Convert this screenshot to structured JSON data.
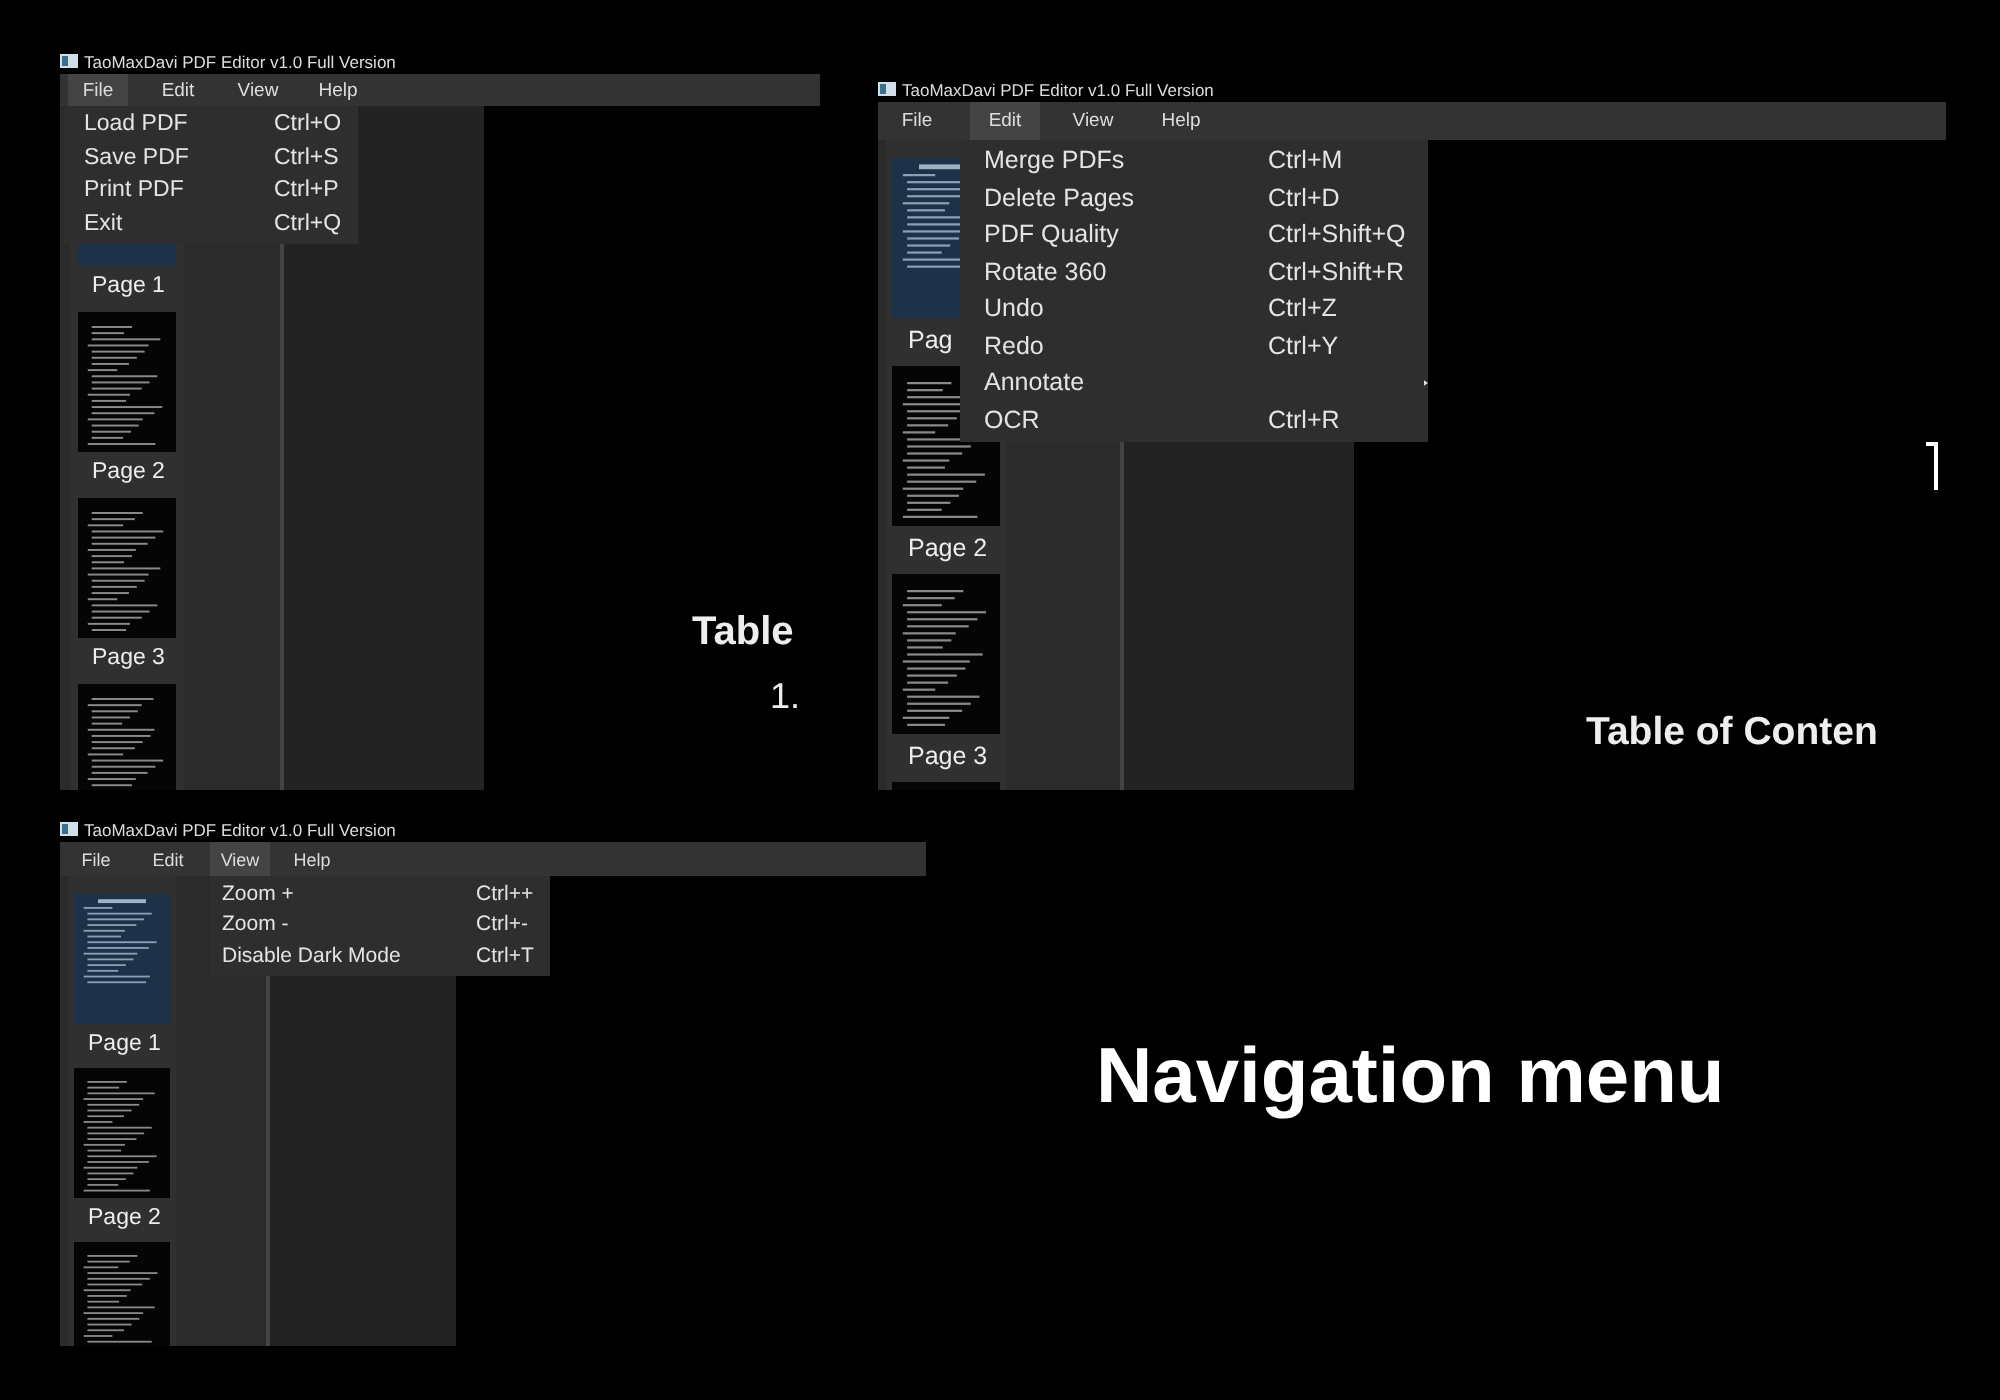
{
  "screens": [
    {
      "title": "TaoMaxDavi PDF Editor v1.0 Full Version",
      "menus": [
        {
          "label": "File",
          "selected": true
        },
        {
          "label": "Edit",
          "selected": false
        },
        {
          "label": "View",
          "selected": false
        },
        {
          "label": "Help",
          "selected": false
        }
      ],
      "dropdown": [
        {
          "label": "Load PDF",
          "shortcut": "Ctrl+O",
          "kind": "command"
        },
        {
          "label": "Save PDF",
          "shortcut": "Ctrl+S",
          "kind": "command"
        },
        {
          "label": "Print PDF",
          "shortcut": "Ctrl+P",
          "kind": "command"
        },
        {
          "label": "Exit",
          "shortcut": "Ctrl+Q",
          "kind": "command"
        }
      ],
      "pages": [
        {
          "label": "Page 1",
          "kind": "cover"
        },
        {
          "label": "Page 2",
          "kind": "text"
        },
        {
          "label": "Page 3",
          "kind": "text"
        },
        {
          "kind": "text"
        }
      ],
      "document": [
        {
          "text": "Table",
          "kind": "heading"
        },
        {
          "text": "1.",
          "kind": "item"
        }
      ]
    },
    {
      "title": "TaoMaxDavi PDF Editor v1.0 Full Version",
      "menus": [
        {
          "label": "File",
          "selected": false
        },
        {
          "label": "Edit",
          "selected": true
        },
        {
          "label": "View",
          "selected": false
        },
        {
          "label": "Help",
          "selected": false
        }
      ],
      "dropdown": [
        {
          "label": "Merge PDFs",
          "shortcut": "Ctrl+M",
          "kind": "command"
        },
        {
          "label": "Delete Pages",
          "shortcut": "Ctrl+D",
          "kind": "command"
        },
        {
          "label": "PDF Quality",
          "shortcut": "Ctrl+Shift+Q",
          "kind": "command"
        },
        {
          "label": "Rotate 360",
          "shortcut": "Ctrl+Shift+R",
          "kind": "command"
        },
        {
          "label": "Undo",
          "shortcut": "Ctrl+Z",
          "kind": "command"
        },
        {
          "label": "Redo",
          "shortcut": "Ctrl+Y",
          "kind": "command"
        },
        {
          "label": "Annotate",
          "kind": "submenu"
        },
        {
          "label": "OCR",
          "shortcut": "Ctrl+R",
          "kind": "command"
        }
      ],
      "pages": [
        {
          "label": "Pag",
          "kind": "cover"
        },
        {
          "label": "Page 2",
          "kind": "text"
        },
        {
          "label": "Page 3",
          "kind": "text"
        },
        {
          "kind": "text"
        }
      ],
      "document": [
        {
          "text": "Table of Conten",
          "kind": "heading"
        }
      ]
    },
    {
      "title": "TaoMaxDavi PDF Editor v1.0 Full Version",
      "menus": [
        {
          "label": "File",
          "selected": false
        },
        {
          "label": "Edit",
          "selected": false
        },
        {
          "label": "View",
          "selected": true
        },
        {
          "label": "Help",
          "selected": false
        }
      ],
      "dropdown": [
        {
          "label": "Zoom +",
          "shortcut": "Ctrl++",
          "kind": "command"
        },
        {
          "label": "Zoom -",
          "shortcut": "Ctrl+-",
          "kind": "command"
        },
        {
          "label": "Disable Dark Mode",
          "shortcut": "Ctrl+T",
          "kind": "command"
        }
      ],
      "pages": [
        {
          "label": "Page 1",
          "kind": "cover"
        },
        {
          "label": "Page 2",
          "kind": "text"
        },
        {
          "kind": "text"
        }
      ]
    }
  ],
  "caption": "Navigation menu"
}
